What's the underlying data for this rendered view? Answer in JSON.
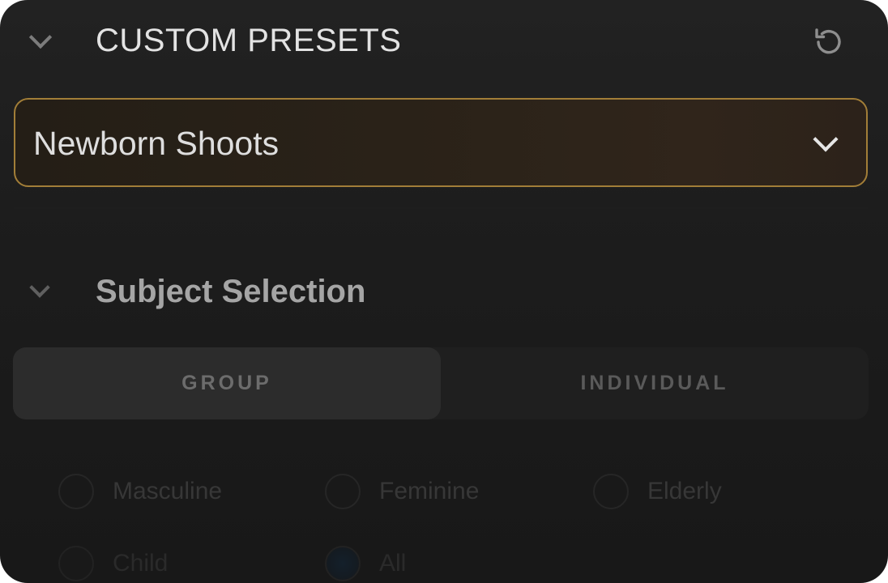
{
  "presets": {
    "section_title": "CUSTOM PRESETS",
    "selected_preset": "Newborn Shoots"
  },
  "subject_selection": {
    "title": "Subject Selection",
    "tabs": [
      {
        "label": "GROUP",
        "active": true
      },
      {
        "label": "INDIVIDUAL",
        "active": false
      }
    ],
    "options": [
      {
        "label": "Masculine",
        "checked": false
      },
      {
        "label": "Feminine",
        "checked": false
      },
      {
        "label": "Elderly",
        "checked": false
      },
      {
        "label": "Child",
        "checked": false
      },
      {
        "label": "All",
        "checked": true
      }
    ]
  },
  "icons": {
    "collapse": "chevron-down-icon",
    "reset": "reset-icon",
    "dropdown": "chevron-down-icon"
  },
  "colors": {
    "accent_border": "#a27e38",
    "panel_background": "#1d1d1d"
  }
}
